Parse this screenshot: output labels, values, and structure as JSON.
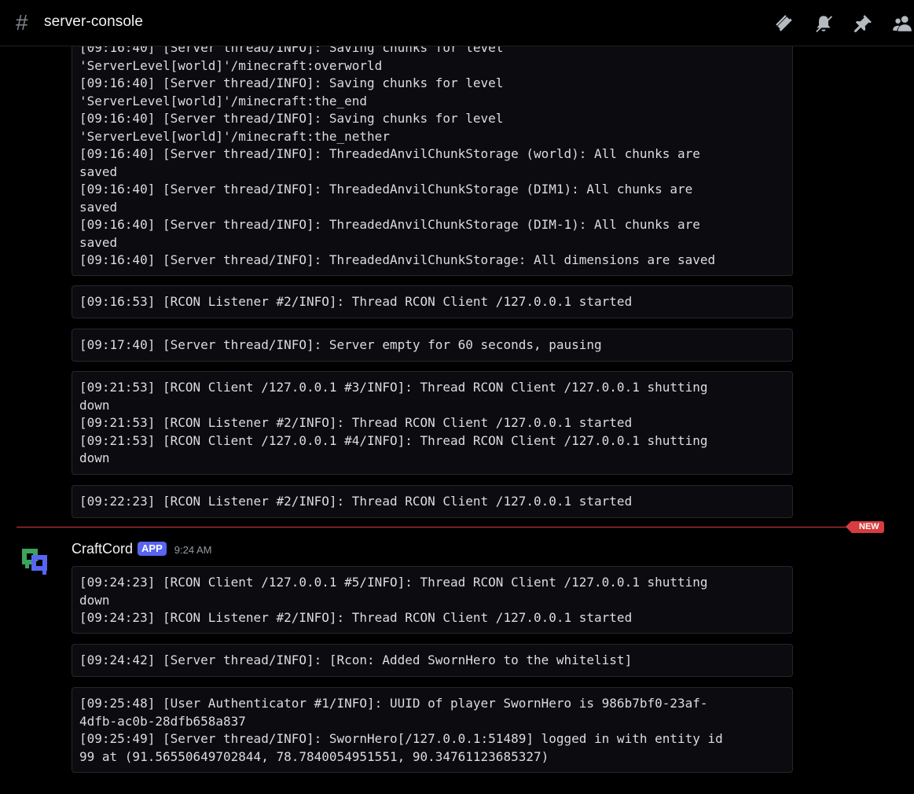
{
  "header": {
    "channel_name": "server-console",
    "icons": [
      "threads-icon",
      "notifications-muted-icon",
      "pin-icon",
      "members-icon"
    ]
  },
  "messages": {
    "blocks": [
      {
        "lines": [
          "[09:16:40] [Server thread/INFO]: Saving chunks for level",
          "'ServerLevel[world]'/minecraft:overworld",
          "[09:16:40] [Server thread/INFO]: Saving chunks for level",
          "'ServerLevel[world]'/minecraft:the_end",
          "[09:16:40] [Server thread/INFO]: Saving chunks for level",
          "'ServerLevel[world]'/minecraft:the_nether",
          "[09:16:40] [Server thread/INFO]: ThreadedAnvilChunkStorage (world): All chunks are",
          "saved",
          "[09:16:40] [Server thread/INFO]: ThreadedAnvilChunkStorage (DIM1): All chunks are",
          "saved",
          "[09:16:40] [Server thread/INFO]: ThreadedAnvilChunkStorage (DIM-1): All chunks are",
          "saved",
          "[09:16:40] [Server thread/INFO]: ThreadedAnvilChunkStorage: All dimensions are saved"
        ]
      },
      {
        "lines": [
          "[09:16:53] [RCON Listener #2/INFO]: Thread RCON Client /127.0.0.1 started"
        ]
      },
      {
        "lines": [
          "[09:17:40] [Server thread/INFO]: Server empty for 60 seconds, pausing"
        ]
      },
      {
        "lines": [
          "[09:21:53] [RCON Client /127.0.0.1 #3/INFO]: Thread RCON Client /127.0.0.1 shutting",
          "down",
          "[09:21:53] [RCON Listener #2/INFO]: Thread RCON Client /127.0.0.1 started",
          "[09:21:53] [RCON Client /127.0.0.1 #4/INFO]: Thread RCON Client /127.0.0.1 shutting",
          "down"
        ]
      },
      {
        "lines": [
          "[09:22:23] [RCON Listener #2/INFO]: Thread RCON Client /127.0.0.1 started"
        ]
      }
    ],
    "new_divider_label": "NEW",
    "author": {
      "name": "CraftCord",
      "tag": "APP",
      "timestamp": "9:24 AM",
      "accent_colors": [
        "#3ba55c",
        "#5865f2"
      ]
    },
    "author_blocks": [
      {
        "lines": [
          "[09:24:23] [RCON Client /127.0.0.1 #5/INFO]: Thread RCON Client /127.0.0.1 shutting",
          "down",
          "[09:24:23] [RCON Listener #2/INFO]: Thread RCON Client /127.0.0.1 started"
        ]
      },
      {
        "lines": [
          "[09:24:42] [Server thread/INFO]: [Rcon: Added SwornHero to the whitelist]"
        ]
      },
      {
        "lines": [
          "[09:25:48] [User Authenticator #1/INFO]: UUID of player SwornHero is 986b7bf0-23af-",
          "4dfb-ac0b-28dfb658a837",
          "[09:25:49] [Server thread/INFO]: SwornHero[/127.0.0.1:51489] logged in with entity id",
          "99 at (91.56550649702844, 78.7840054951551, 90.34761123685327)"
        ]
      }
    ]
  }
}
